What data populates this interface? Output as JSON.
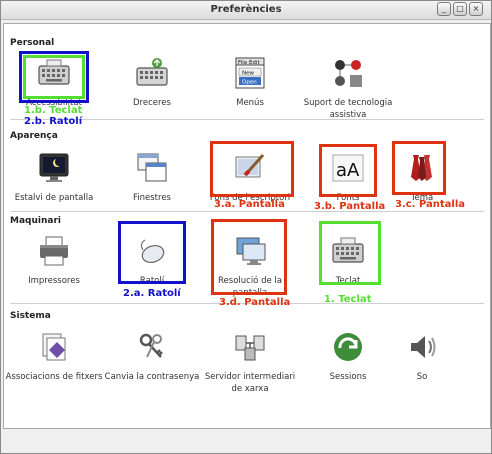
{
  "window": {
    "title": "Preferències",
    "buttons": [
      "_",
      "□",
      "×"
    ]
  },
  "colors": {
    "green": "#55dd33",
    "blue": "#1111cc",
    "red": "#dd3311"
  },
  "sections": {
    "personal": {
      "title": "Personal",
      "items": [
        {
          "label": "Accessibilitat",
          "icon": "keyboard-icon"
        },
        {
          "label": "Dreceres",
          "icon": "shortcuts-keyboard-icon"
        },
        {
          "label": "Menús",
          "icon": "menu-file-edit-icon",
          "mini": [
            "File Edit",
            "New",
            "Open"
          ]
        },
        {
          "label": "Suport de tecnologia assistiva",
          "icon": "assistive-tech-icon"
        }
      ]
    },
    "aparenca": {
      "title": "Aparença",
      "items": [
        {
          "label": "Estalvi de pantalla",
          "icon": "screensaver-monitor-icon"
        },
        {
          "label": "Finestres",
          "icon": "windows-icon"
        },
        {
          "label": "Fons de l'escriptori",
          "icon": "wallpaper-brush-icon"
        },
        {
          "label": "Fonts",
          "icon": "font-aA-icon",
          "glyph": "aA"
        },
        {
          "label": "Tema",
          "icon": "theme-ties-icon"
        }
      ]
    },
    "maquinari": {
      "title": "Maquinari",
      "items": [
        {
          "label": "Impressores",
          "icon": "printer-icon"
        },
        {
          "label": "Ratolí",
          "icon": "mouse-icon"
        },
        {
          "label": "Resolució de la pantalla",
          "icon": "screen-resolution-icon"
        },
        {
          "label": "Teclat",
          "icon": "keyboard-icon"
        }
      ]
    },
    "sistema": {
      "title": "Sistema",
      "items": [
        {
          "label": "Associacions de fitxers",
          "icon": "file-associations-icon"
        },
        {
          "label": "Canvia la contrasenya",
          "icon": "keys-icon"
        },
        {
          "label": "Servidor intermediari de xarxa",
          "icon": "network-proxy-icon"
        },
        {
          "label": "Sessions",
          "icon": "sessions-icon"
        },
        {
          "label": "So",
          "icon": "sound-icon"
        }
      ]
    }
  },
  "annotations": [
    "1.b. Teclat",
    "2.b. Ratolí",
    "3.a. Pantalla",
    "3.b. Pantalla",
    "3.c. Pantalla",
    "2.a. Ratolí",
    "3.d. Pantalla",
    "1. Teclat"
  ]
}
